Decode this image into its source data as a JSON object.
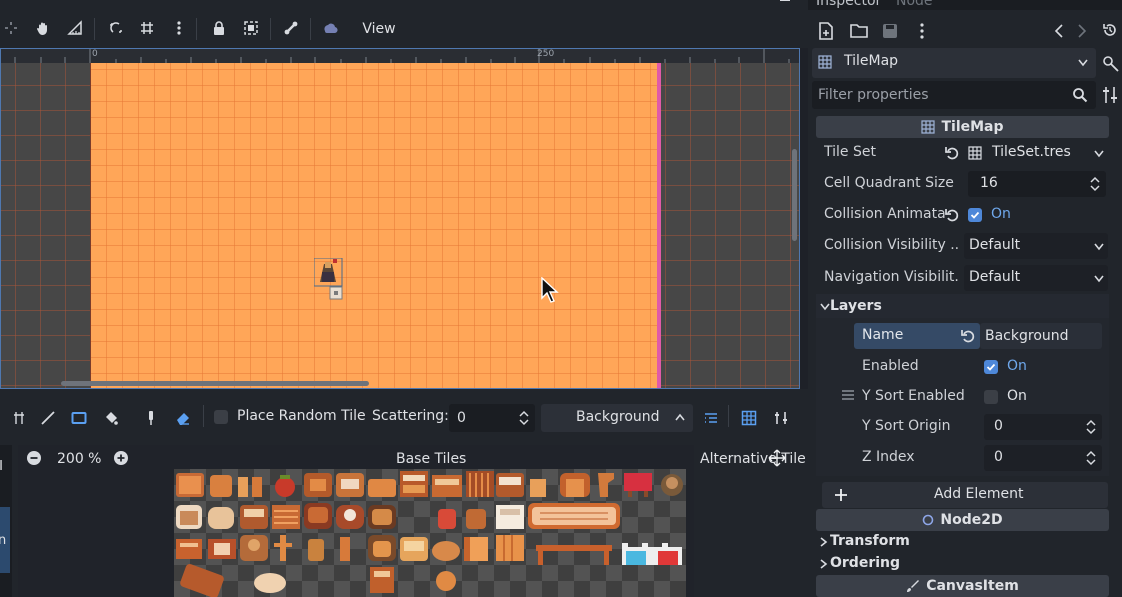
{
  "toolbar": {
    "view_label": "View",
    "icons": [
      "select-icon",
      "pan-icon",
      "ruler-icon",
      "smart-snap-icon",
      "grid-snap-icon",
      "more-icon",
      "lock-icon",
      "group-icon",
      "skeleton-icon",
      "meshes-icon"
    ]
  },
  "viewport": {
    "ruler_labels": [
      "0",
      "250"
    ]
  },
  "tilemap_panel": {
    "tools": [
      "select-tool-icon",
      "paint-tool-icon",
      "line-tool-icon",
      "rect-tool-icon",
      "bucket-tool-icon",
      "picker-tool-icon",
      "eraser-tool-icon"
    ],
    "random_tile_label": "Place Random Tile",
    "random_tile_checked": false,
    "scattering_label": "Scattering:",
    "scattering_value": "0",
    "layer_value": "Background",
    "zoom_value": "200 %",
    "base_tiles_title": "Base Tiles",
    "alternative_tiles_title": "Alternative Tile",
    "left_strip_fragments": [
      "(I",
      "n"
    ]
  },
  "inspector": {
    "tabs": [
      "Inspector",
      "Node"
    ],
    "node_type": "TileMap",
    "filter_placeholder": "Filter properties",
    "section_tilemap": "TileMap",
    "properties": {
      "tile_set": {
        "label": "Tile Set",
        "value": "TileSet.tres"
      },
      "cell_quadrant_size": {
        "label": "Cell Quadrant Size",
        "value": "16"
      },
      "collision_animatable": {
        "label": "Collision Animata...",
        "value": "On",
        "checked": true
      },
      "collision_visibility": {
        "label": "Collision Visibility ...",
        "value": "Default"
      },
      "navigation_visibility": {
        "label": "Navigation Visibilit...",
        "value": "Default"
      }
    },
    "layers_group": "Layers",
    "layer": {
      "name": {
        "label": "Name",
        "value": "Background"
      },
      "enabled": {
        "label": "Enabled",
        "value": "On",
        "checked": true
      },
      "y_sort_enabled": {
        "label": "Y Sort Enabled",
        "value": "On",
        "checked": false
      },
      "y_sort_origin": {
        "label": "Y Sort Origin",
        "value": "0"
      },
      "z_index": {
        "label": "Z Index",
        "value": "0"
      }
    },
    "add_element_label": "Add Element",
    "section_node2d": "Node2D",
    "transform_group": "Transform",
    "ordering_group": "Ordering",
    "section_canvasitem": "CanvasItem"
  },
  "colors": {
    "accent": "#4e88d9",
    "canvas_orange": "#ffa658",
    "grid_line": "#e06a2a",
    "viewport_border": "#4f78b0",
    "bound_pink": "#e05aa8"
  }
}
